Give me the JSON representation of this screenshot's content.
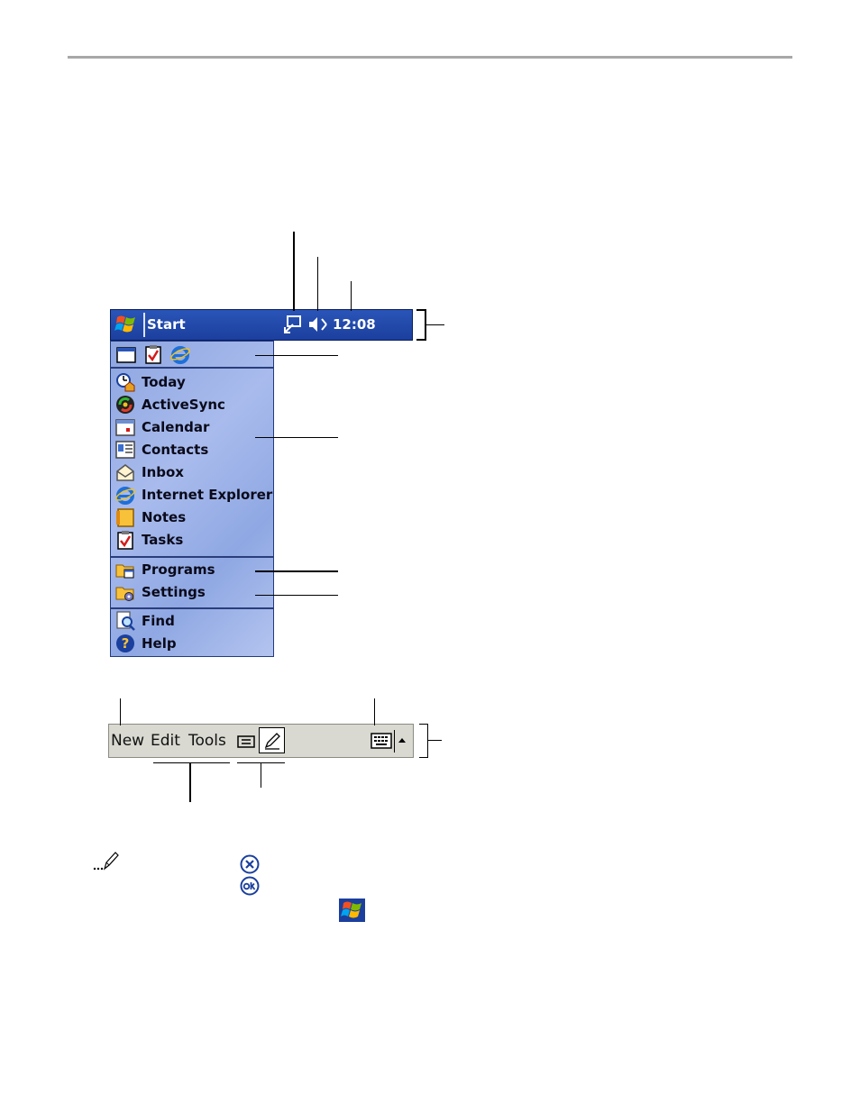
{
  "title_bar": {
    "start_label": "Start",
    "clock": "12:08",
    "icons": [
      "windows-flag-icon",
      "connectivity-icon",
      "speaker-muted-icon"
    ]
  },
  "start_menu": {
    "recent_icons": [
      "window-icon",
      "tasks-icon",
      "internet-explorer-icon"
    ],
    "programs": [
      {
        "label": "Today",
        "icon": "today-icon"
      },
      {
        "label": "ActiveSync",
        "icon": "activesync-icon"
      },
      {
        "label": "Calendar",
        "icon": "calendar-icon"
      },
      {
        "label": "Contacts",
        "icon": "contacts-icon"
      },
      {
        "label": "Inbox",
        "icon": "inbox-icon"
      },
      {
        "label": "Internet Explorer",
        "icon": "internet-explorer-icon"
      },
      {
        "label": "Notes",
        "icon": "notes-icon"
      },
      {
        "label": "Tasks",
        "icon": "tasks-icon"
      }
    ],
    "folders": [
      {
        "label": "Programs",
        "icon": "programs-folder-icon"
      },
      {
        "label": "Settings",
        "icon": "settings-folder-icon"
      }
    ],
    "tools": [
      {
        "label": "Find",
        "icon": "find-icon"
      },
      {
        "label": "Help",
        "icon": "help-icon"
      }
    ]
  },
  "command_bar": {
    "menus": [
      "New",
      "Edit",
      "Tools"
    ],
    "icons": [
      "record-icon",
      "pen-icon",
      "keyboard-icon",
      "up-arrow-icon"
    ]
  },
  "note": {
    "icons": [
      "note-pencil-icon",
      "close-x-icon",
      "ok-icon",
      "windows-flag-icon"
    ]
  },
  "colors": {
    "title_bar": "#1b3f9d",
    "menu_bg": "#a9bbed",
    "command_bar": "#d9d9d1"
  }
}
